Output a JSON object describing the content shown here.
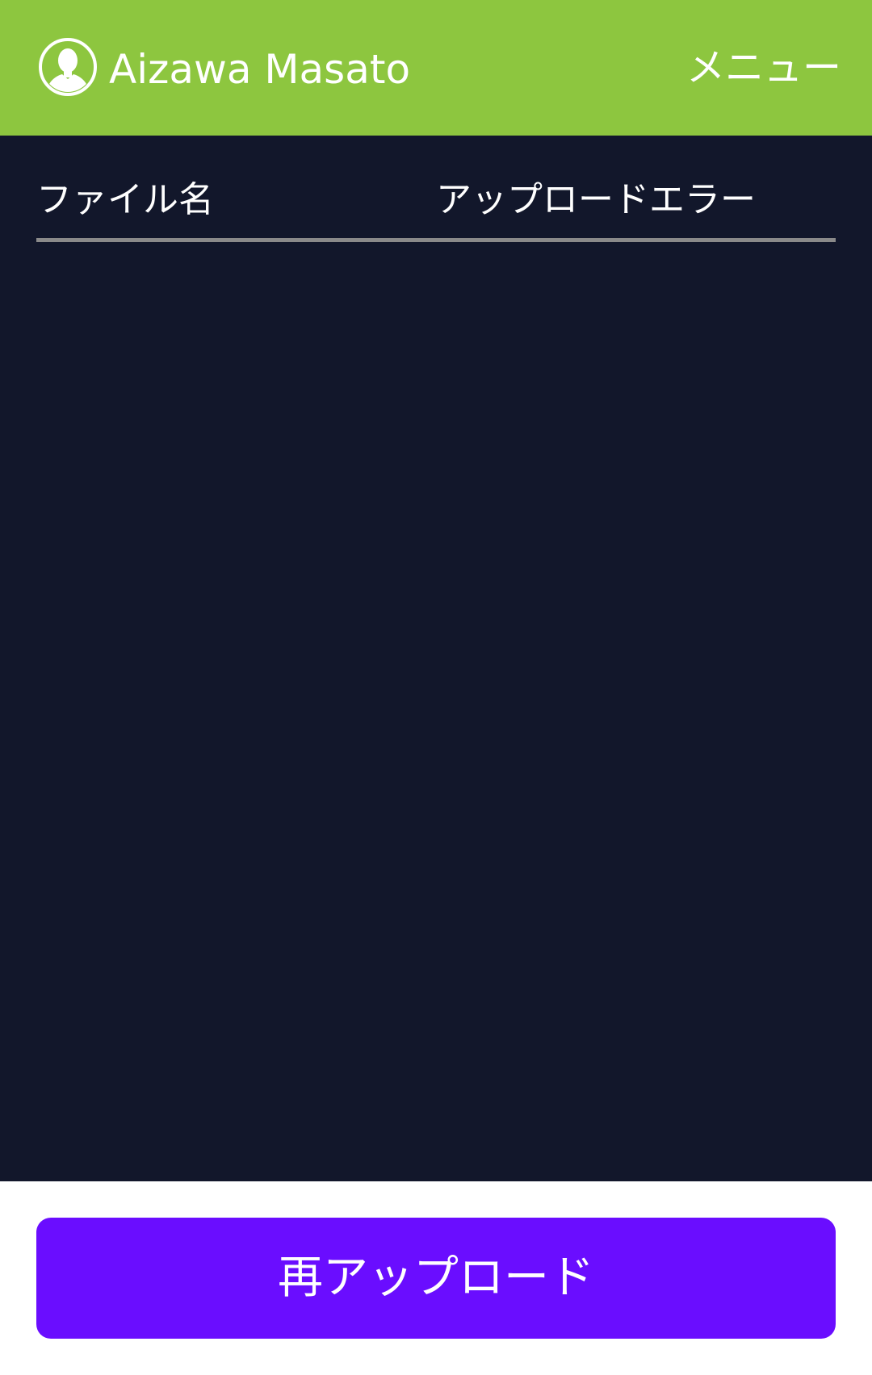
{
  "header": {
    "avatar_icon": "user-avatar-icon",
    "user_name": "Aizawa Masato",
    "menu_label": "メニュー",
    "background_color": "#8dc63f"
  },
  "table": {
    "columns": [
      "ファイル名",
      "アップロードエラー"
    ],
    "rows": [],
    "background_color": "#12172b"
  },
  "footer": {
    "reupload_label": "再アップロード",
    "button_color": "#6a0dff"
  }
}
